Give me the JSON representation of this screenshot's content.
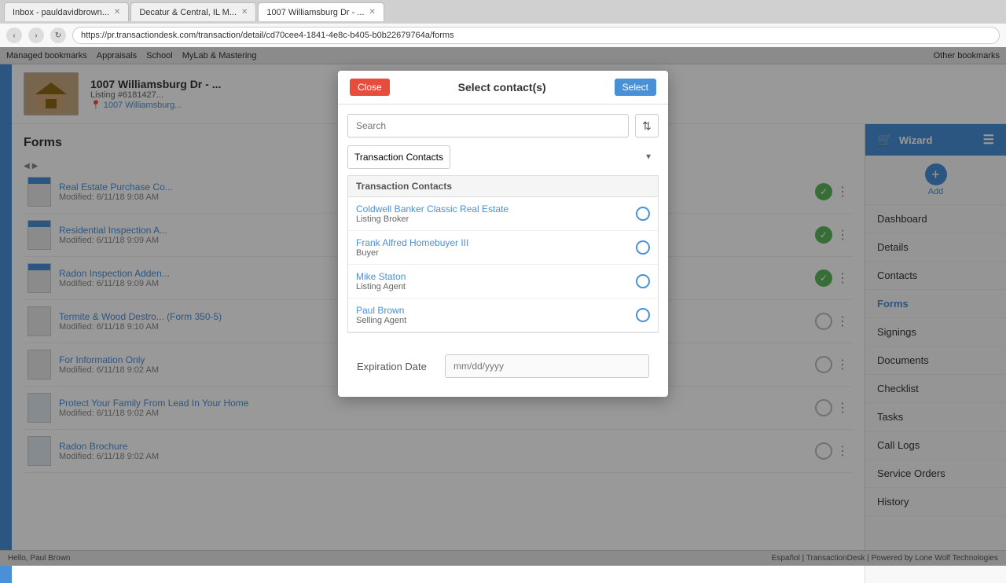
{
  "browser": {
    "tabs": [
      {
        "id": "tab1",
        "label": "Inbox - pauldavidbrown...",
        "active": false
      },
      {
        "id": "tab2",
        "label": "Decatur & Central, IL M...",
        "active": false
      },
      {
        "id": "tab3",
        "label": "1007 Williamsburg Dr - ...",
        "active": true
      }
    ],
    "address": "https://pr.transactiondesk.com/transaction/detail/cd70cee4-1841-4e8c-b405-b0b22679764a/forms",
    "bookmarks": [
      "Managed bookmarks",
      "Appraisals",
      "School",
      "MyLab & Mastering",
      "Other bookmarks"
    ]
  },
  "property": {
    "name": "1007 Williamsburg Dr - ...",
    "listing_label": "Listing #6181427...",
    "address": "1007 Williamsburg..."
  },
  "sections": {
    "forms_title": "Forms",
    "add_label": "Add"
  },
  "forms": [
    {
      "id": "f1",
      "name": "Real Estate Purchase Co...",
      "modified": "Modified: 6/11/18 9:08 AM",
      "status": "checked",
      "has_icon": true
    },
    {
      "id": "f2",
      "name": "Residential Inspection A...",
      "modified": "Modified: 6/11/18 9:09 AM",
      "status": "checked",
      "has_icon": true
    },
    {
      "id": "f3",
      "name": "Radon Inspection Adden...",
      "modified": "Modified: 6/11/18 9:09 AM",
      "status": "checked",
      "has_icon": true
    },
    {
      "id": "f4",
      "name": "Termite & Wood Destro... (Form 350-5)",
      "modified": "Modified: 6/11/18 9:10 AM",
      "status": "empty",
      "has_icon": false
    },
    {
      "id": "f5",
      "name": "For Information Only",
      "modified": "Modified: 6/11/18 9:02 AM",
      "status": "empty",
      "has_icon": false
    },
    {
      "id": "f6",
      "name": "Protect Your Family From Lead In Your Home",
      "modified": "Modified: 6/11/18 9:02 AM",
      "status": "empty",
      "has_icon": true,
      "has_thumbnail": true
    },
    {
      "id": "f7",
      "name": "Radon Brochure",
      "modified": "Modified: 6/11/18 9:02 AM",
      "status": "empty",
      "has_icon": true,
      "has_thumbnail": true
    }
  ],
  "right_sidebar": {
    "wizard_label": "Wizard",
    "nav_items": [
      {
        "id": "dashboard",
        "label": "Dashboard",
        "active": false
      },
      {
        "id": "details",
        "label": "Details",
        "active": false
      },
      {
        "id": "contacts",
        "label": "Contacts",
        "active": false
      },
      {
        "id": "forms",
        "label": "Forms",
        "active": true
      },
      {
        "id": "signings",
        "label": "Signings",
        "active": false
      },
      {
        "id": "documents",
        "label": "Documents",
        "active": false
      },
      {
        "id": "checklist",
        "label": "Checklist",
        "active": false
      },
      {
        "id": "tasks",
        "label": "Tasks",
        "active": false
      },
      {
        "id": "call-logs",
        "label": "Call Logs",
        "active": false
      },
      {
        "id": "service-orders",
        "label": "Service Orders",
        "active": false
      },
      {
        "id": "history",
        "label": "History",
        "active": false
      }
    ]
  },
  "modal": {
    "title": "Select contact(s)",
    "close_label": "Close",
    "select_label": "Select",
    "search_placeholder": "Search",
    "filter_option": "Transaction Contacts",
    "contacts_section_header": "Transaction Contacts",
    "contacts": [
      {
        "id": "c1",
        "name": "Coldwell Banker Classic Real Estate",
        "role": "Listing Broker",
        "selected": false
      },
      {
        "id": "c2",
        "name": "Frank Alfred Homebuyer III",
        "role": "Buyer",
        "selected": false
      },
      {
        "id": "c3",
        "name": "Mike Staton",
        "role": "Listing Agent",
        "selected": false
      },
      {
        "id": "c4",
        "name": "Paul Brown",
        "role": "Selling Agent",
        "selected": false
      }
    ],
    "expiration_label": "Expiration Date",
    "expiration_placeholder": "mm/dd/yyyy"
  },
  "status_bar": {
    "left": "Hello, Paul Brown",
    "middle_links": [
      "TransactionDesk",
      "Powered by Lone Wolf Technologies"
    ],
    "right": "Español | TransactionDesk | Powered by Lone Wolf Technologies"
  },
  "colors": {
    "accent_blue": "#4a90d9",
    "close_red": "#e74c3c",
    "green": "#5cb85c"
  }
}
